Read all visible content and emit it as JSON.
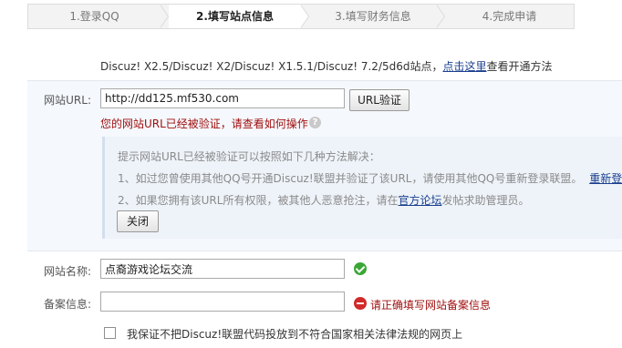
{
  "steps": [
    {
      "label": "1.登录QQ"
    },
    {
      "label": "2.填写站点信息"
    },
    {
      "label": "3.填写财务信息"
    },
    {
      "label": "4.完成申请"
    }
  ],
  "intro": {
    "text": "Discuz! X2.5/Discuz! X2/Discuz! X1.5.1/Discuz! 7.2/5d6d站点，",
    "link": "点击这里",
    "suffix": "查看开通方法"
  },
  "url_field": {
    "label": "网站URL:",
    "value": "http://dd125.mf530.com",
    "verify_button": "URL验证",
    "error": "您的网站URL已经被验证，请查看如何操作",
    "help_icon": "?"
  },
  "tip": {
    "heading": "提示网站URL已经被验证可以按照如下几种方法解决：",
    "line1": "1、如过您曾使用其他QQ号开通Discuz!联盟并验证了该URL，请使用其他QQ号重新登录联盟。",
    "line1_link": "重新登录",
    "line2_prefix": "2、如果您拥有该URL所有权限，被其他人恶意抢注，请在",
    "line2_link": "官方论坛",
    "line2_suffix": "发帖求助管理员。",
    "close_button": "关闭"
  },
  "site_name": {
    "label": "网站名称:",
    "value": "点裔游戏论坛交流"
  },
  "record": {
    "label": "备案信息:",
    "value": "",
    "error": "请正确填写网站备案信息"
  },
  "agreement": {
    "label": "我保证不把Discuz!联盟代码投放到不符合国家相关法律法规的网页上"
  },
  "colors": {
    "error": "#a01010",
    "link": "#1a3f8f",
    "ok": "#3aa735",
    "error_icon": "#d12a2a"
  }
}
